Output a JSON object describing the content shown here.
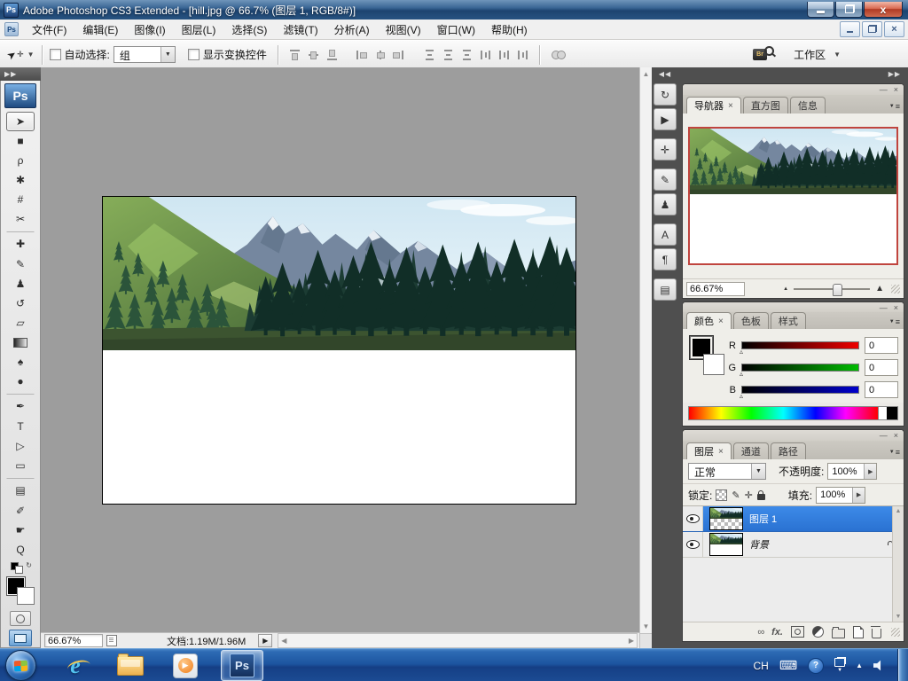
{
  "title_bar": {
    "title": "Adobe Photoshop CS3 Extended - [hill.jpg @ 66.7% (图层 1, RGB/8#)]",
    "app_logo": "Ps"
  },
  "menu_bar": {
    "doc_logo": "Ps",
    "items": [
      {
        "label": "文件(F)",
        "name": "menu-file"
      },
      {
        "label": "编辑(E)",
        "name": "menu-edit"
      },
      {
        "label": "图像(I)",
        "name": "menu-image"
      },
      {
        "label": "图层(L)",
        "name": "menu-layer"
      },
      {
        "label": "选择(S)",
        "name": "menu-select"
      },
      {
        "label": "滤镜(T)",
        "name": "menu-filter"
      },
      {
        "label": "分析(A)",
        "name": "menu-analysis"
      },
      {
        "label": "视图(V)",
        "name": "menu-view"
      },
      {
        "label": "窗口(W)",
        "name": "menu-window"
      },
      {
        "label": "帮助(H)",
        "name": "menu-help"
      }
    ]
  },
  "options_bar": {
    "auto_select_label": "自动选择:",
    "auto_select_value": "组",
    "show_transform_label": "显示变换控件",
    "bridge_label": "Br",
    "workspace_label": "工作区"
  },
  "tool_panel": {
    "collapse_glyph": "▶▶",
    "logo": "Ps",
    "tools": [
      {
        "name": "move-tool",
        "glyph": "➤",
        "cls": "selected"
      },
      {
        "name": "rectangular-marquee-tool",
        "glyph": "■"
      },
      {
        "name": "lasso-tool",
        "glyph": "ρ"
      },
      {
        "name": "quick-selection-tool",
        "glyph": "✱"
      },
      {
        "name": "crop-tool",
        "glyph": "#"
      },
      {
        "name": "slice-tool",
        "glyph": "✂"
      },
      {
        "name": "healing-brush-tool",
        "glyph": "✚",
        "cls": "sep"
      },
      {
        "name": "brush-tool",
        "glyph": "✎"
      },
      {
        "name": "clone-stamp-tool",
        "glyph": "♟"
      },
      {
        "name": "history-brush-tool",
        "glyph": "↺"
      },
      {
        "name": "eraser-tool",
        "glyph": "▱"
      },
      {
        "name": "gradient-tool",
        "glyph": "▰",
        "cls": "grad"
      },
      {
        "name": "blur-tool",
        "glyph": "♠"
      },
      {
        "name": "dodge-tool",
        "glyph": "●"
      },
      {
        "name": "pen-tool",
        "glyph": "✒",
        "cls": "sep"
      },
      {
        "name": "type-tool",
        "glyph": "T"
      },
      {
        "name": "path-selection-tool",
        "glyph": "▷"
      },
      {
        "name": "shape-tool",
        "glyph": "▭"
      },
      {
        "name": "notes-tool",
        "glyph": "▤",
        "cls": "sep"
      },
      {
        "name": "eyedropper-tool",
        "glyph": "✐"
      },
      {
        "name": "hand-tool",
        "glyph": "☛"
      },
      {
        "name": "zoom-tool",
        "glyph": "Q"
      }
    ]
  },
  "dock_strip": {
    "buttons": [
      {
        "name": "history-panel-button",
        "glyph": "↻"
      },
      {
        "name": "actions-panel-button",
        "glyph": "▶"
      },
      {
        "name": "tool-presets-panel-button",
        "glyph": "✛",
        "cls": "g"
      },
      {
        "name": "brushes-panel-button",
        "glyph": "✎",
        "cls": "g"
      },
      {
        "name": "clone-source-panel-button",
        "glyph": "♟"
      },
      {
        "name": "character-panel-button",
        "glyph": "A",
        "cls": "g"
      },
      {
        "name": "paragraph-panel-button",
        "glyph": "¶"
      },
      {
        "name": "layer-comps-panel-button",
        "glyph": "▤",
        "cls": "g"
      }
    ]
  },
  "panels": {
    "collapse_glyph": "▶▶",
    "navigator": {
      "tabs": [
        {
          "label": "导航器",
          "cls": "active",
          "name": "tab-navigator"
        },
        {
          "label": "直方图",
          "name": "tab-histogram"
        },
        {
          "label": "信息",
          "name": "tab-info"
        }
      ],
      "zoom_value": "66.67%"
    },
    "color": {
      "tabs": [
        {
          "label": "颜色",
          "cls": "active",
          "name": "tab-color"
        },
        {
          "label": "色板",
          "name": "tab-swatches"
        },
        {
          "label": "样式",
          "name": "tab-styles"
        }
      ],
      "channels": [
        {
          "label": "R",
          "value": "0",
          "cls": "r",
          "name": "red-channel-row"
        },
        {
          "label": "G",
          "value": "0",
          "cls": "g",
          "name": "green-channel-row"
        },
        {
          "label": "B",
          "value": "0",
          "cls": "b",
          "name": "blue-channel-row"
        }
      ]
    },
    "layers": {
      "tabs": [
        {
          "label": "图层",
          "cls": "active",
          "name": "tab-layers"
        },
        {
          "label": "通道",
          "name": "tab-channels"
        },
        {
          "label": "路径",
          "name": "tab-paths"
        }
      ],
      "blend_mode": "正常",
      "opacity_label": "不透明度:",
      "opacity_value": "100%",
      "lock_label": "锁定:",
      "fill_label": "填充:",
      "fill_value": "100%",
      "rows": [
        {
          "label": "图层 1",
          "cls": "selected",
          "name": "layer-row-layer1"
        },
        {
          "label": "背景",
          "cls": "background",
          "name": "layer-row-background"
        }
      ],
      "fx_label": "fx."
    }
  },
  "status_bar": {
    "zoom": "66.67%",
    "doc_label": "文档:1.19M/1.96M"
  },
  "taskbar": {
    "photoshop_label": "Ps",
    "ie_label": "e",
    "help_label": "?",
    "tray_language": "CH",
    "keyboard_glyph": "⌨"
  },
  "glyphs": {
    "tab_close": "×",
    "dropdown": "▼",
    "spinner": "▶",
    "panel_minimize": "—",
    "panel_close": "×",
    "panel_menu": "≡",
    "panel_menu_tri": "▼",
    "scroll_up": "▲",
    "scroll_down": "▼",
    "scroll_left": "◀",
    "scroll_right": "▶",
    "status_flyout": "▶",
    "link_icon_glyph": "∞",
    "mini_swap_glyph": "↻",
    "nav_zoom_out": "▲",
    "nav_zoom_in": "▲",
    "collapse_left": "◀◀",
    "win_close": "×",
    "lock_paint": "✎",
    "lock_position": "✛",
    "tray_up": "▲",
    "tray_flag_down": "▼"
  }
}
